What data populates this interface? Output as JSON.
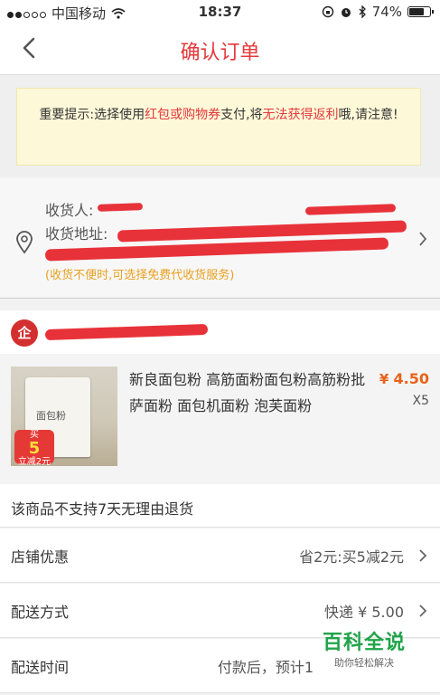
{
  "status_bar": {
    "carrier": "中国移动",
    "time": "18:37",
    "battery": "74%",
    "battery_level": 0.74
  },
  "nav": {
    "title": "确认订单"
  },
  "notice": {
    "prefix": "重要提示:选择使用",
    "red1": "红包或购物券",
    "mid": "支付,将",
    "red2": "无法获得返利",
    "suffix": "哦,请注意!"
  },
  "address": {
    "receiver_label": "收货人:",
    "address_label": "收货地址:",
    "note": "(收货不便时,可选择免费代收货服务)"
  },
  "shop": {
    "logo_text": "企"
  },
  "product": {
    "name": "新良面包粉 高筋面粉面包粉高筋粉批萨面粉 面包机面粉 泡芙面粉",
    "price_symbol": "¥",
    "price": "4.50",
    "quantity": "X5",
    "thumb_bag_label": "面包粉",
    "thumb_badge_top": "买",
    "thumb_badge_num": "5",
    "thumb_badge_bottom": "立减2元"
  },
  "return_policy": "该商品不支持7天无理由退货",
  "rows": {
    "shop_discount": {
      "label": "店铺优惠",
      "value": "省2元:买5减2元"
    },
    "delivery_method": {
      "label": "配送方式",
      "value": "快递 ¥ 5.00"
    },
    "delivery_time": {
      "label": "配送时间",
      "value": "付款后，预计1"
    }
  },
  "watermark": {
    "title": "百科全说",
    "subtitle": "助你轻松解决"
  },
  "colors": {
    "accent": "#e4393c",
    "note": "#e8a020",
    "price": "#e8631a"
  }
}
